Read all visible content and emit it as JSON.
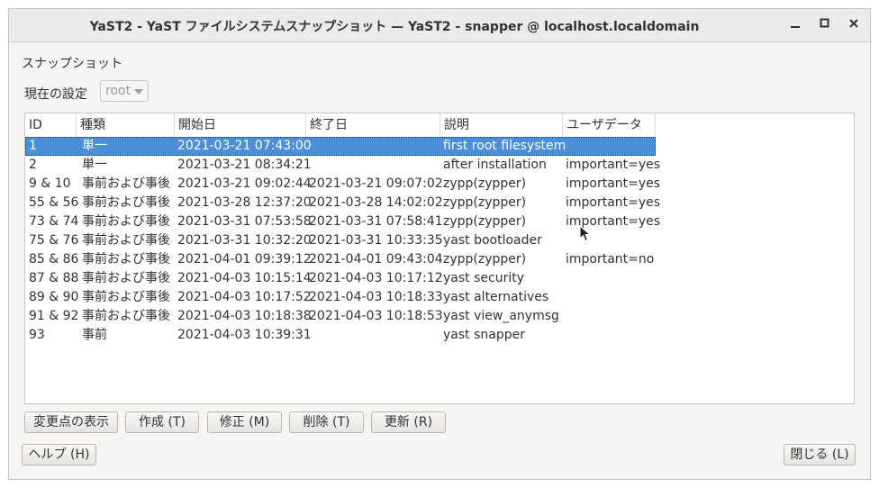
{
  "window": {
    "title": "YaST2 - YaST ファイルシステムスナップショット — YaST2 - snapper @ localhost.localdomain",
    "minimize_icon": "minimize-icon",
    "maximize_icon": "maximize-icon",
    "close_icon": "close-icon"
  },
  "section_label": "スナップショット",
  "config": {
    "label": "現在の設定",
    "value": "root"
  },
  "table": {
    "headers": [
      "ID",
      "種類",
      "開始日",
      "終了日",
      "説明",
      "ユーザデータ"
    ],
    "rows": [
      {
        "id": "1",
        "type": "単一",
        "start": "2021-03-21 07:43:00",
        "end": "",
        "desc": "first root filesystem",
        "user": ""
      },
      {
        "id": "2",
        "type": "単一",
        "start": "2021-03-21 08:34:21",
        "end": "",
        "desc": "after installation",
        "user": "important=yes"
      },
      {
        "id": "9 & 10",
        "type": "事前および事後",
        "start": "2021-03-21 09:02:44",
        "end": "2021-03-21 09:07:02",
        "desc": "zypp(zypper)",
        "user": "important=yes"
      },
      {
        "id": "55 & 56",
        "type": "事前および事後",
        "start": "2021-03-28 12:37:20",
        "end": "2021-03-28 14:02:02",
        "desc": "zypp(zypper)",
        "user": "important=yes"
      },
      {
        "id": "73 & 74",
        "type": "事前および事後",
        "start": "2021-03-31 07:53:58",
        "end": "2021-03-31 07:58:41",
        "desc": "zypp(zypper)",
        "user": "important=yes"
      },
      {
        "id": "75 & 76",
        "type": "事前および事後",
        "start": "2021-03-31 10:32:20",
        "end": "2021-03-31 10:33:35",
        "desc": "yast bootloader",
        "user": ""
      },
      {
        "id": "85 & 86",
        "type": "事前および事後",
        "start": "2021-04-01 09:39:12",
        "end": "2021-04-01 09:43:04",
        "desc": "zypp(zypper)",
        "user": "important=no"
      },
      {
        "id": "87 & 88",
        "type": "事前および事後",
        "start": "2021-04-03 10:15:14",
        "end": "2021-04-03 10:17:12",
        "desc": "yast security",
        "user": ""
      },
      {
        "id": "89 & 90",
        "type": "事前および事後",
        "start": "2021-04-03 10:17:52",
        "end": "2021-04-03 10:18:33",
        "desc": "yast alternatives",
        "user": ""
      },
      {
        "id": "91 & 92",
        "type": "事前および事後",
        "start": "2021-04-03 10:18:38",
        "end": "2021-04-03 10:18:53",
        "desc": "yast view_anymsg",
        "user": ""
      },
      {
        "id": "93",
        "type": "事前",
        "start": "2021-04-03 10:39:31",
        "end": "",
        "desc": "yast snapper",
        "user": ""
      }
    ]
  },
  "buttons": {
    "show_changes": "変更点の表示",
    "create": "作成 (T)",
    "modify": "修正 (M)",
    "delete": "削除 (T)",
    "refresh": "更新 (R)",
    "help": "ヘルプ (H)",
    "close": "閉じる (L)"
  }
}
